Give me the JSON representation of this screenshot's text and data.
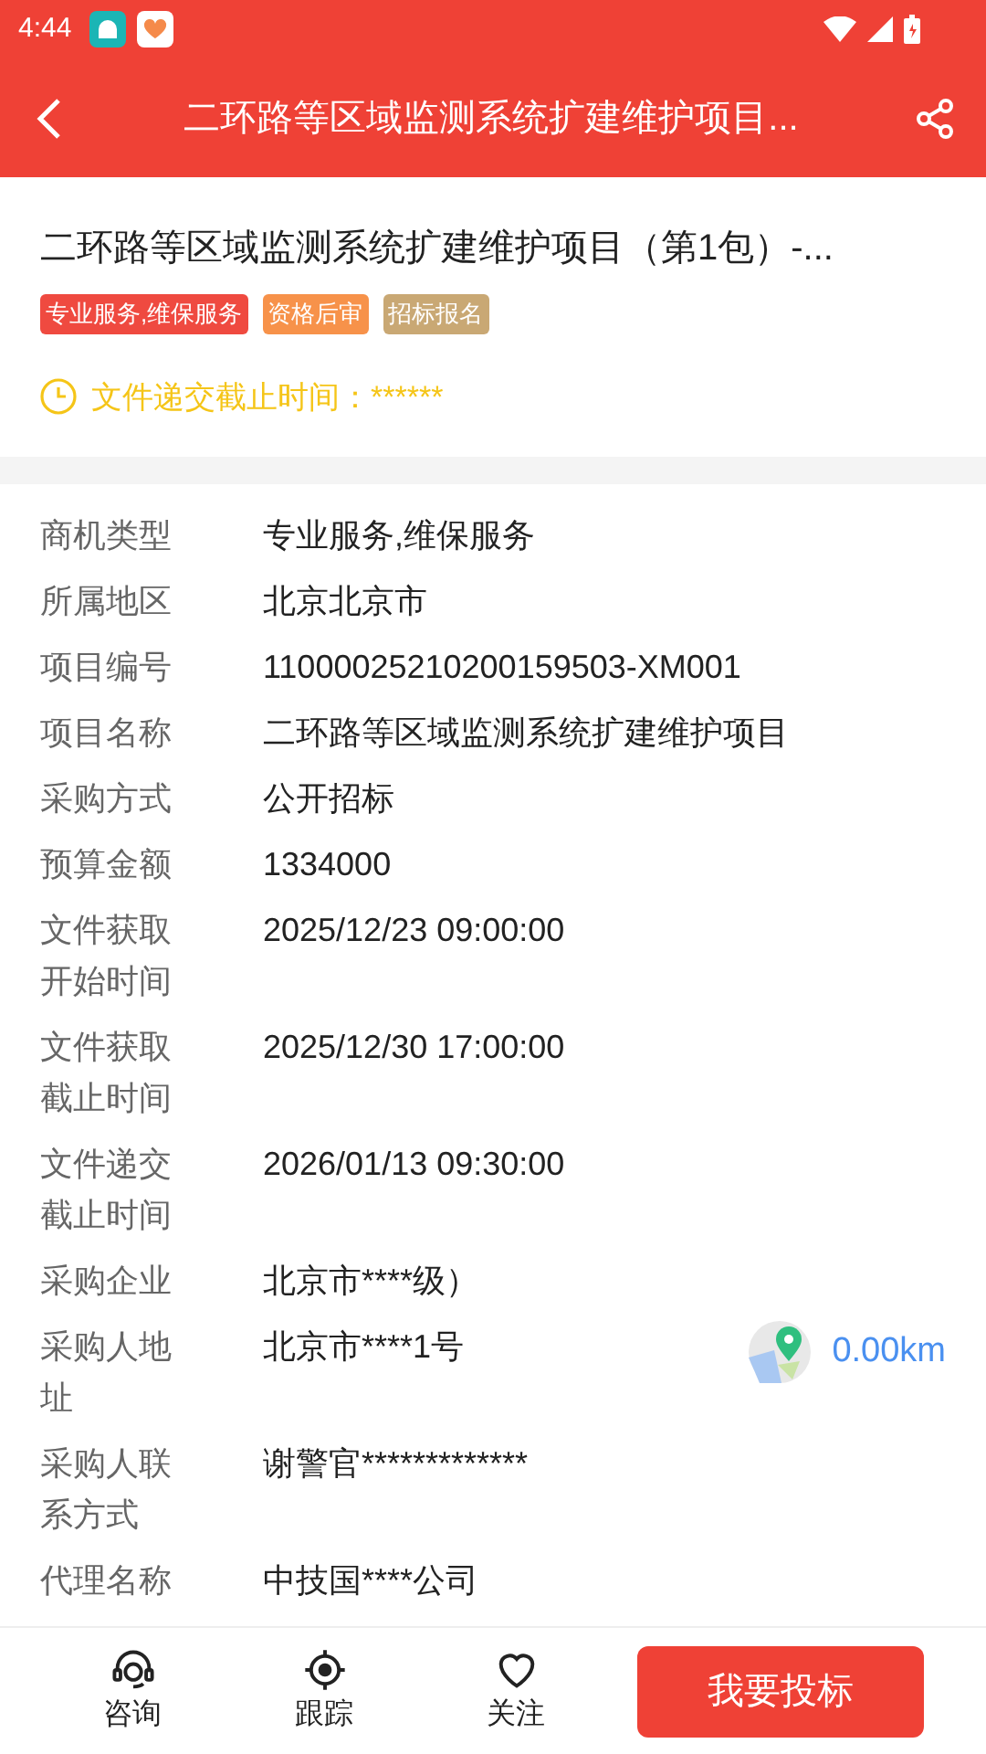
{
  "status_bar": {
    "time": "4:44"
  },
  "header": {
    "title": "二环路等区域监测系统扩建维护项目..."
  },
  "summary": {
    "title": "二环路等区域监测系统扩建维护项目（第1包）-...",
    "tags": [
      {
        "label": "专业服务,维保服务",
        "color": "#ef4a40"
      },
      {
        "label": "资格后审",
        "color": "#f7924a"
      },
      {
        "label": "招标报名",
        "color": "#c9a874"
      }
    ],
    "deadline": "文件递交截止时间：******"
  },
  "details": [
    {
      "label": "商机类型",
      "value": "专业服务,维保服务"
    },
    {
      "label": "所属地区",
      "value": "北京北京市"
    },
    {
      "label": "项目编号",
      "value": "11000025210200159503-XM001"
    },
    {
      "label": "项目名称",
      "value": "二环路等区域监测系统扩建维护项目"
    },
    {
      "label": "采购方式",
      "value": "公开招标"
    },
    {
      "label": "预算金额",
      "value": "1334000"
    },
    {
      "label": "文件获取开始时间",
      "value": "2025/12/23 09:00:00"
    },
    {
      "label": "文件获取截止时间",
      "value": "2025/12/30 17:00:00"
    },
    {
      "label": "文件递交截止时间",
      "value": "2026/01/13 09:30:00"
    },
    {
      "label": "采购企业",
      "value": "北京市****级）"
    },
    {
      "label": "采购人地址",
      "value": "北京市****1号",
      "distance": "0.00km"
    },
    {
      "label": "采购人联系方式",
      "value": "谢警官*************"
    },
    {
      "label": "代理名称",
      "value": "中技国****公司"
    }
  ],
  "bottom_bar": {
    "actions": [
      {
        "kind": "consult",
        "label": "咨询"
      },
      {
        "kind": "track",
        "label": "跟踪"
      },
      {
        "kind": "follow",
        "label": "关注"
      }
    ],
    "primary": "我要投标"
  }
}
